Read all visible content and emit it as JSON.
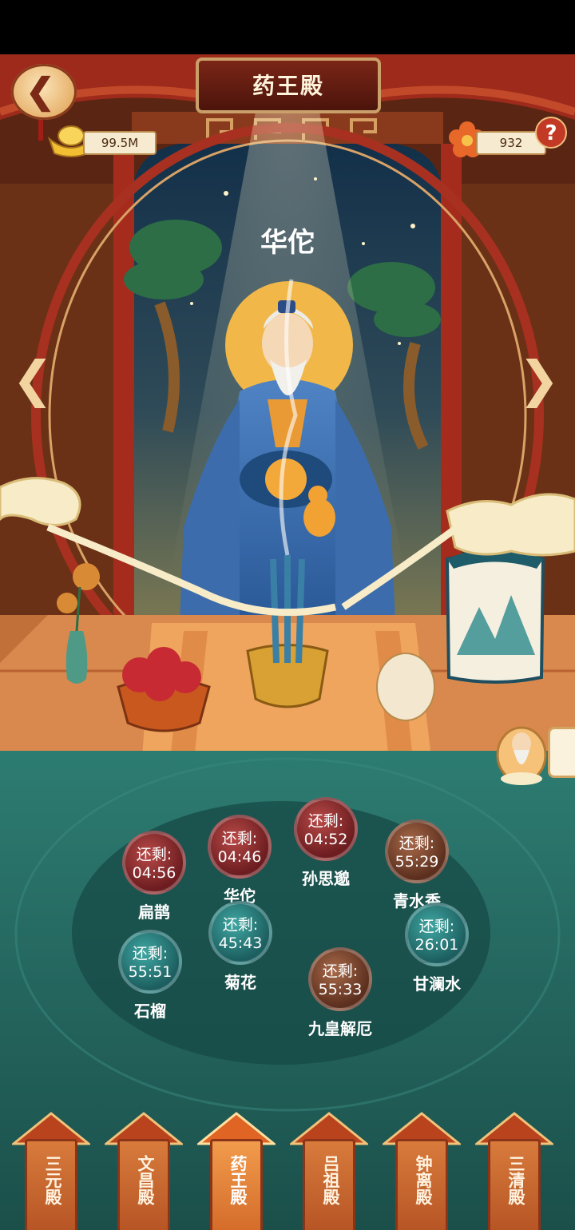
{
  "header": {
    "title": "药王殿",
    "back_icon": "back-chevron-icon"
  },
  "currency": {
    "gold": "99.5M",
    "flowers": "932"
  },
  "deity": {
    "name": "华佗"
  },
  "offerings": [
    {
      "id": "bianque",
      "label": "扁鹊",
      "timer_prefix": "还剩:",
      "time": "04:56",
      "color": "red"
    },
    {
      "id": "huatuo",
      "label": "华佗",
      "timer_prefix": "还剩:",
      "time": "04:46",
      "color": "red"
    },
    {
      "id": "sunsimiao",
      "label": "孙思邈",
      "timer_prefix": "还剩:",
      "time": "04:52",
      "color": "red"
    },
    {
      "id": "qingshuixiang",
      "label": "青水香",
      "timer_prefix": "还剩:",
      "time": "55:29",
      "color": "brown"
    },
    {
      "id": "juhua",
      "label": "菊花",
      "timer_prefix": "还剩:",
      "time": "45:43",
      "color": "green"
    },
    {
      "id": "ganlanshui",
      "label": "甘澜水",
      "timer_prefix": "还剩:",
      "time": "26:01",
      "color": "green"
    },
    {
      "id": "shiliu",
      "label": "石榴",
      "timer_prefix": "还剩:",
      "time": "55:51",
      "color": "green"
    },
    {
      "id": "jiuhuang",
      "label": "九皇解厄",
      "timer_prefix": "还剩:",
      "time": "55:33",
      "color": "brown"
    }
  ],
  "halls": [
    {
      "label": "三元殿",
      "active": false
    },
    {
      "label": "文昌殿",
      "active": false
    },
    {
      "label": "药王殿",
      "active": true
    },
    {
      "label": "吕祖殿",
      "active": false
    },
    {
      "label": "钟离殿",
      "active": false
    },
    {
      "label": "三清殿",
      "active": false
    }
  ],
  "colors": {
    "temple_red": "#9d2a1a",
    "floor_teal": "#1f5f5a",
    "accent_gold": "#f0c060",
    "halo": "#f1b849"
  }
}
